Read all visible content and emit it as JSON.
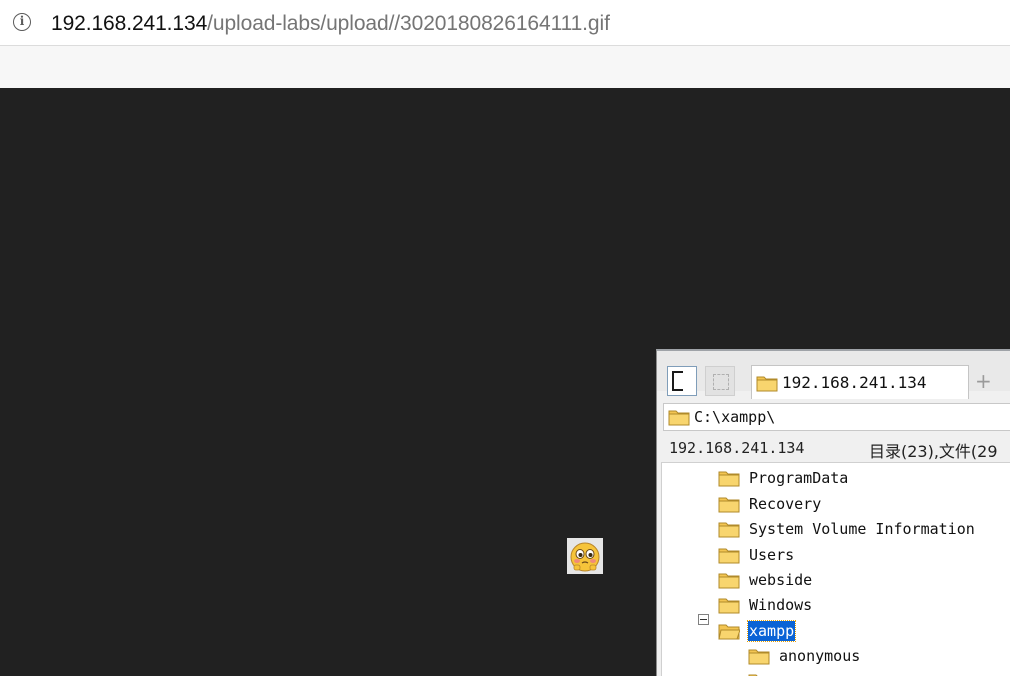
{
  "browser": {
    "url_host": "192.168.241.134",
    "url_path": "/upload-labs/upload//3020180826164111.gif",
    "info_icon": "info-icon"
  },
  "page": {
    "background": "#212121",
    "image_icon": "blushing-face-emoji"
  },
  "file_manager": {
    "tab_label": "192.168.241.134",
    "tab_add": "+",
    "path": "C:\\xampp\\",
    "status_host": "192.168.241.134",
    "status_counts": "目录(23),文件(29",
    "folders": [
      {
        "label": "ProgramData",
        "selected": false
      },
      {
        "label": "Recovery",
        "selected": false
      },
      {
        "label": "System Volume Information",
        "selected": false
      },
      {
        "label": "Users",
        "selected": false
      },
      {
        "label": "webside",
        "selected": false
      },
      {
        "label": "Windows",
        "selected": false
      },
      {
        "label": "xampp",
        "selected": true,
        "expanded": true
      },
      {
        "label": "anonymous",
        "selected": false
      }
    ],
    "colors": {
      "selection": "#0a63d6",
      "folder": "#f3c552"
    }
  }
}
